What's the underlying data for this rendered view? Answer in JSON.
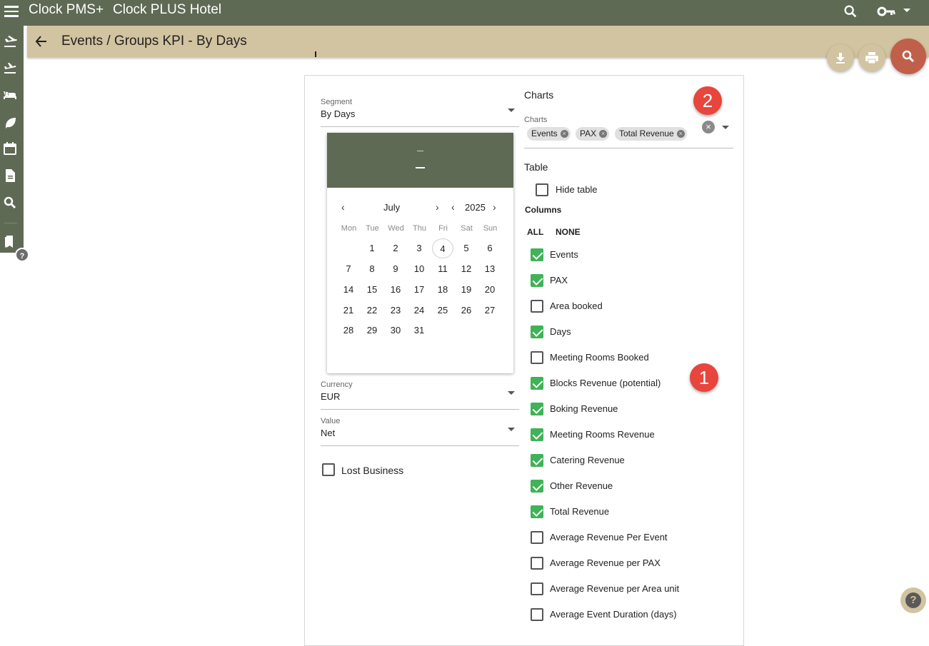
{
  "topbar": {
    "app_name": "Clock PMS+",
    "hotel_name": "Clock PLUS Hotel"
  },
  "subbar": {
    "title": "Events / Groups KPI - By Days"
  },
  "form": {
    "segment": {
      "label": "Segment",
      "value": "By Days"
    },
    "currency": {
      "label": "Currency",
      "value": "EUR"
    },
    "value": {
      "label": "Value",
      "value": "Net"
    },
    "lost_business": {
      "label": "Lost Business",
      "checked": false
    }
  },
  "calendar": {
    "month": "July",
    "year": "2025",
    "weekdays": [
      "Mon",
      "Tue",
      "Wed",
      "Thu",
      "Fri",
      "Sat",
      "Sun"
    ],
    "today": "4",
    "days": [
      "1",
      "2",
      "3",
      "4",
      "5",
      "6",
      "7",
      "8",
      "9",
      "10",
      "11",
      "12",
      "13",
      "14",
      "15",
      "16",
      "17",
      "18",
      "19",
      "20",
      "21",
      "22",
      "23",
      "24",
      "25",
      "26",
      "27",
      "28",
      "29",
      "30",
      "31"
    ]
  },
  "charts": {
    "section_title": "Charts",
    "field_label": "Charts",
    "chips": [
      "Events",
      "PAX",
      "Total Revenue"
    ]
  },
  "table": {
    "section_title": "Table",
    "hide_table_label": "Hide table",
    "hide_table_checked": false,
    "columns_title": "Columns",
    "all_label": "ALL",
    "none_label": "NONE",
    "columns": [
      {
        "label": "Events",
        "checked": true
      },
      {
        "label": "PAX",
        "checked": true
      },
      {
        "label": "Area booked",
        "checked": false
      },
      {
        "label": "Days",
        "checked": true
      },
      {
        "label": "Meeting Rooms Booked",
        "checked": false
      },
      {
        "label": "Blocks Revenue (potential)",
        "checked": true
      },
      {
        "label": "Boking Revenue",
        "checked": true
      },
      {
        "label": "Meeting Rooms Revenue",
        "checked": true
      },
      {
        "label": "Catering Revenue",
        "checked": true
      },
      {
        "label": "Other Revenue",
        "checked": true
      },
      {
        "label": "Total Revenue",
        "checked": true
      },
      {
        "label": "Average Revenue Per Event",
        "checked": false
      },
      {
        "label": "Average Revenue per PAX",
        "checked": false
      },
      {
        "label": "Average Revenue per Area unit",
        "checked": false
      },
      {
        "label": "Average Event Duration (days)",
        "checked": false
      }
    ]
  },
  "annotations": {
    "badge_1": "1",
    "badge_2": "2"
  },
  "sidebar": {
    "icons": [
      "arrivals-icon",
      "departures-icon",
      "bed-icon",
      "leaf-icon",
      "calendar-icon",
      "document-icon",
      "search-icon",
      "bookmark-icon"
    ]
  },
  "colors": {
    "topbar": "#5f6a55",
    "subbar": "#d2c3a1",
    "check_green": "#3fb357",
    "badge_red": "#e8453c",
    "search_fab": "#c0604a"
  }
}
